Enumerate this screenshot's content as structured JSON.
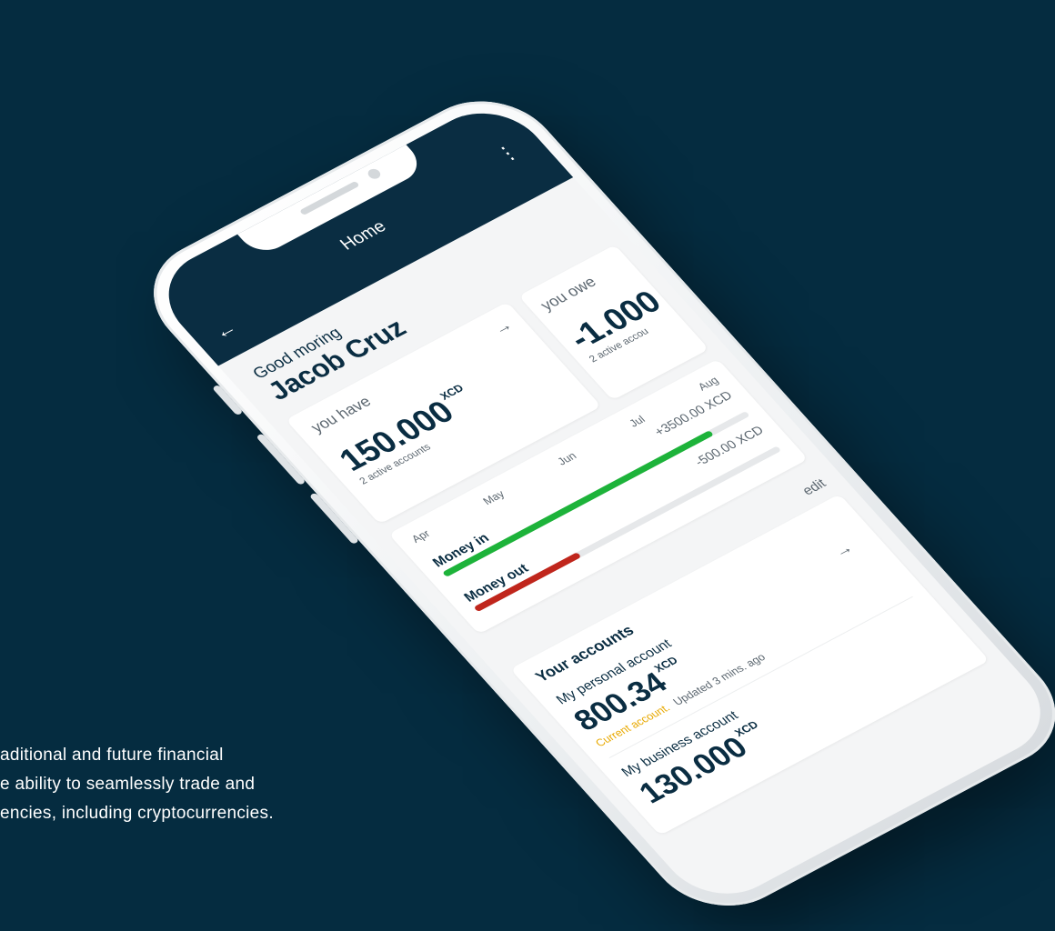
{
  "colors": {
    "background": "#052c40",
    "app_bar": "#0a2d42",
    "money_in": "#1db33a",
    "money_out": "#c0261c",
    "current_account": "#e8a900"
  },
  "caption": {
    "lines": [
      "aditional and future financial",
      "e ability to seamlessly trade and",
      "encies, including cryptocurrencies."
    ]
  },
  "app_bar": {
    "title": "Home",
    "back_icon": "back-arrow-icon",
    "menu_icon": "more-vertical-icon"
  },
  "greeting": {
    "small": "Good moring",
    "name": "Jacob Cruz"
  },
  "you_have": {
    "label": "you have",
    "amount": "150.000",
    "currency": "XCD",
    "sub": "2 active accounts"
  },
  "you_owe": {
    "label": "you owe",
    "amount": "-1.000",
    "sub": "2 active accou"
  },
  "money": {
    "months": [
      "Apr",
      "May",
      "Jun",
      "Jul",
      "Aug"
    ],
    "in_label": "Money in",
    "in_value": "+3500.00 XCD",
    "in_fraction": 0.88,
    "out_label": "Money out",
    "out_value": "-500.00 XCD",
    "out_fraction": 0.34
  },
  "accounts": {
    "edit_label": "edit",
    "title": "Your accounts",
    "items": [
      {
        "name": "My personal account",
        "amount": "800.34",
        "currency": "XCD",
        "type": "Current account.",
        "updated": "Updated 3 mins. ago"
      },
      {
        "name": "My business account",
        "amount": "130.000",
        "currency": "XCD"
      }
    ]
  }
}
